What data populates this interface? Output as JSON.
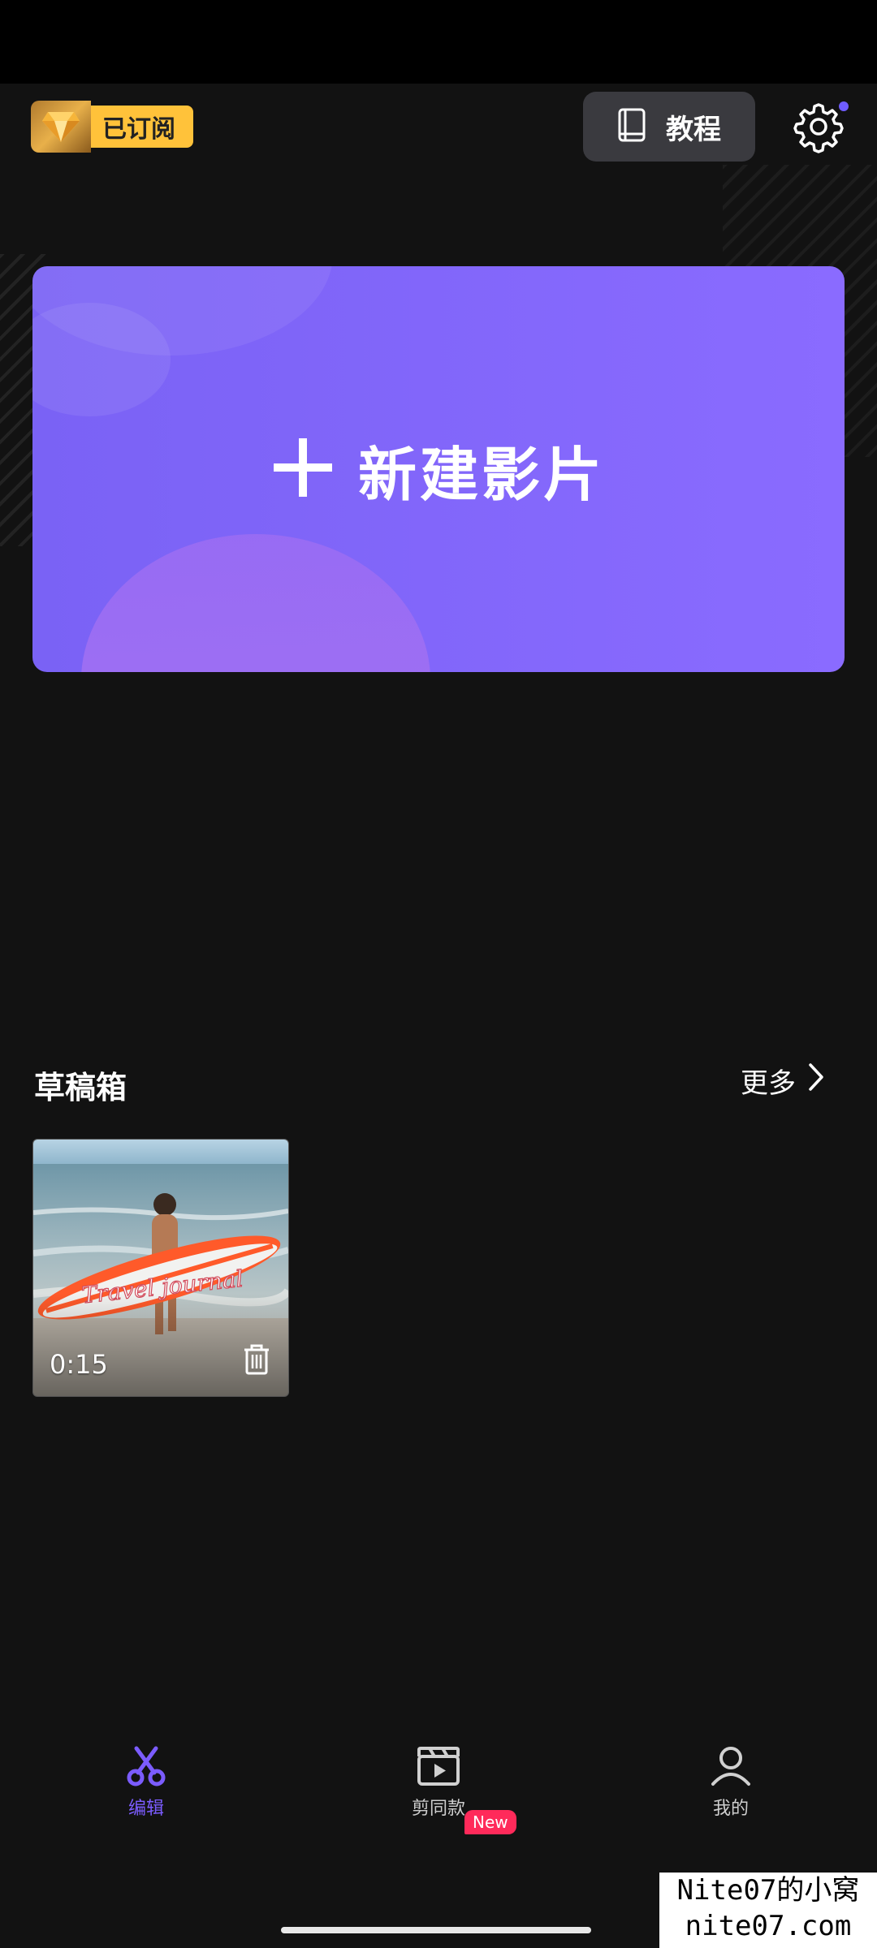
{
  "header": {
    "subscription_label": "已订阅",
    "tutorial_label": "教程",
    "icons": {
      "gem": "diamond-icon",
      "book": "book-icon",
      "settings": "gear-icon"
    },
    "notification_dot_color": "#6f5cff"
  },
  "new_project": {
    "label": "新建影片",
    "icon": "plus-icon",
    "color": "#7a62f5"
  },
  "drafts": {
    "title": "草稿箱",
    "more_label": "更多",
    "items": [
      {
        "duration": "0:15",
        "thumbnail_text": "Travel journal",
        "icon": "trash-icon"
      }
    ]
  },
  "bottom_nav": {
    "items": [
      {
        "label": "编辑",
        "icon": "scissors-icon",
        "active": true
      },
      {
        "label": "剪同款",
        "icon": "clapperboard-icon",
        "active": false,
        "badge": "New"
      },
      {
        "label": "我的",
        "icon": "person-icon",
        "active": false
      }
    ],
    "active_color": "#7b5cff"
  },
  "watermark": {
    "line1": "Nite07的小窝",
    "line2": "nite07.com"
  }
}
